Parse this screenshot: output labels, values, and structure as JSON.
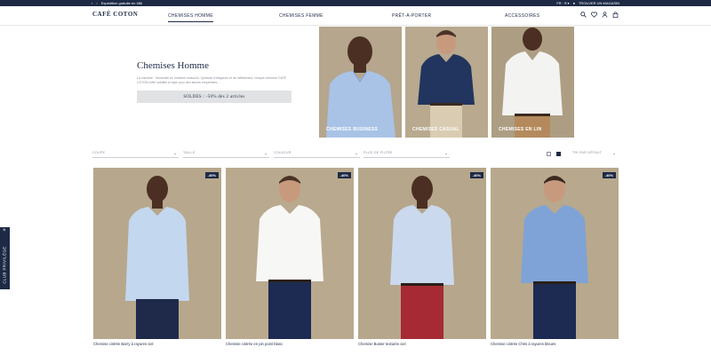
{
  "topbar": {
    "left_text": "Expédition gratuite en 48h",
    "prev_icon": "chevron-left-icon",
    "next_icon": "chevron-right-icon",
    "lang": "FR · € ▾",
    "store_link": "TROUVER UN MAGASIN"
  },
  "nav": {
    "logo": "CAFÉ COTON",
    "items": [
      {
        "label": "CHEMISES HOMME",
        "active": true
      },
      {
        "label": "CHEMISES FEMME",
        "active": false
      },
      {
        "label": "PRÊT-À-PORTER",
        "active": false
      },
      {
        "label": "ACCESSOIRES",
        "active": false
      }
    ],
    "icons": [
      "search-icon",
      "heart-icon",
      "user-icon",
      "bag-icon"
    ]
  },
  "hero": {
    "title": "Chemises Homme",
    "description": "La chemise : l'essentiel du vestiaire masculin. Symbole d'élégance et de raffinement, chaque chemise CAFÉ COTON mêle subtilité et style pour des allures empreintes...",
    "promo": "SOLDES : -50% dès 2 articles"
  },
  "categories": [
    {
      "label": "CHEMISES BUSINESS",
      "shirt": "#a9c3e6",
      "bg": "#b5a68d"
    },
    {
      "label": "CHEMISES CASUAL",
      "shirt": "#22355e",
      "bg": "#b8a98f"
    },
    {
      "label": "CHEMISES EN LIN",
      "shirt": "#f3f3f1",
      "bg": "#ad9e83"
    }
  ],
  "filters": {
    "items": [
      "COUPE",
      "TAILLE",
      "COULEUR",
      "PLUS DE FILTRE"
    ],
    "sort": "TRI PAR DÉFAUT"
  },
  "products": [
    {
      "name": "Chemise cintrée Barry à rayures ciel",
      "badge": "-40%",
      "shirt": "#c3d7ef",
      "pants": "#1f2a4a",
      "skin": "#4a2f22"
    },
    {
      "name": "Chemise cintrée en pin point blanc",
      "badge": "-40%",
      "shirt": "#f7f7f5",
      "pants": "#1d2b52",
      "skin": "#c79a7e"
    },
    {
      "name": "Chemise Buster texturée ciel",
      "badge": "-40%",
      "shirt": "#cad9ee",
      "pants": "#a52a34",
      "skin": "#4a2f22"
    },
    {
      "name": "Chemise cintrée Chris à rayures bleues",
      "badge": "-40%",
      "shirt": "#7fa3d6",
      "pants": "#1d2b52",
      "skin": "#c79a7e"
    }
  ],
  "club": {
    "label": "CLUB PRIVILÈGE",
    "close": "×"
  },
  "colors": {
    "navy": "#1e2a45",
    "promo_bg": "#e1e2e4",
    "photo_bg": "#b7a78c"
  }
}
